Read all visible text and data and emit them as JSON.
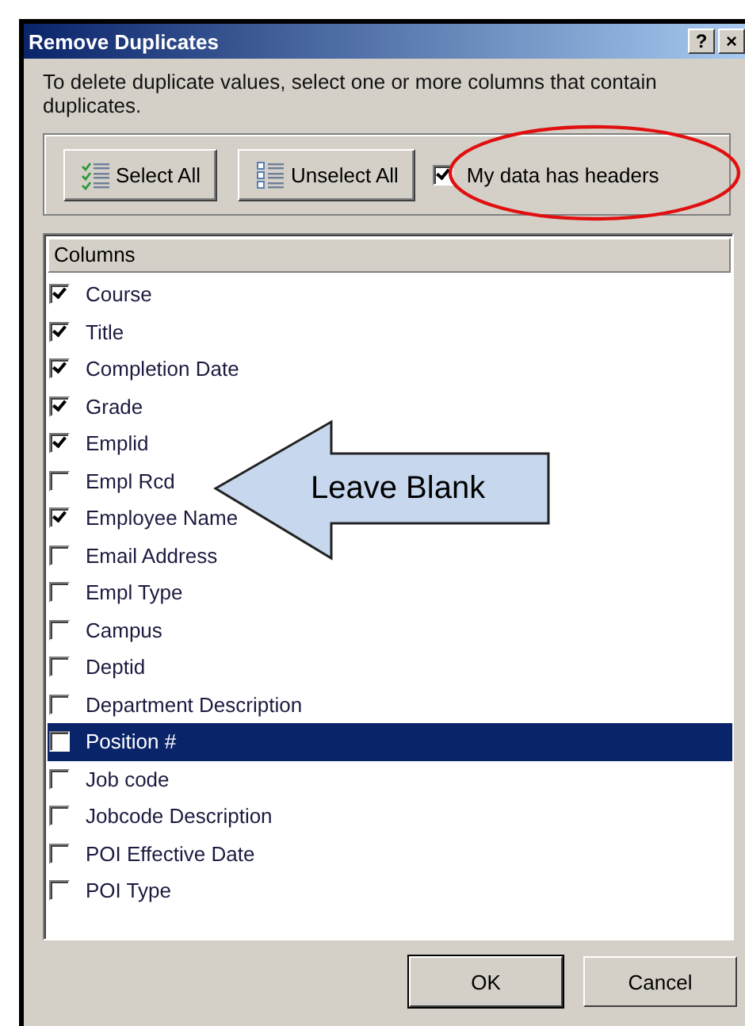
{
  "window": {
    "title": "Remove Duplicates",
    "title_buttons": [
      "?",
      "×"
    ]
  },
  "instructions": "To delete duplicate values, select one or more columns that contain duplicates.",
  "toolbar": {
    "buttons": [
      {
        "label": "Select All",
        "kind": "select"
      },
      {
        "label": "Unselect All",
        "kind": "unselect"
      }
    ],
    "headers_checkbox": {
      "label": "My data has headers",
      "checked": true
    }
  },
  "list": {
    "header": "Columns",
    "items": [
      {
        "label": "Course",
        "checked": true,
        "selected": false
      },
      {
        "label": "Title",
        "checked": true,
        "selected": false
      },
      {
        "label": "Completion Date",
        "checked": true,
        "selected": false
      },
      {
        "label": "Grade",
        "checked": true,
        "selected": false
      },
      {
        "label": "Emplid",
        "checked": true,
        "selected": false
      },
      {
        "label": "Empl Rcd",
        "checked": false,
        "selected": false
      },
      {
        "label": "Employee Name",
        "checked": true,
        "selected": false
      },
      {
        "label": "Email Address",
        "checked": false,
        "selected": false
      },
      {
        "label": "Empl Type",
        "checked": false,
        "selected": false
      },
      {
        "label": "Campus",
        "checked": false,
        "selected": false
      },
      {
        "label": "Deptid",
        "checked": false,
        "selected": false
      },
      {
        "label": "Department Description",
        "checked": false,
        "selected": false
      },
      {
        "label": "Position #",
        "checked": false,
        "selected": true
      },
      {
        "label": "Job code",
        "checked": false,
        "selected": false
      },
      {
        "label": "Jobcode Description",
        "checked": false,
        "selected": false
      },
      {
        "label": "POI Effective Date",
        "checked": false,
        "selected": false
      },
      {
        "label": "POI Type",
        "checked": false,
        "selected": false
      }
    ]
  },
  "buttons": [
    "OK",
    "Cancel"
  ],
  "annotations": [
    {
      "kind": "ellipse"
    },
    {
      "kind": "arrow",
      "text": "Leave Blank"
    }
  ]
}
